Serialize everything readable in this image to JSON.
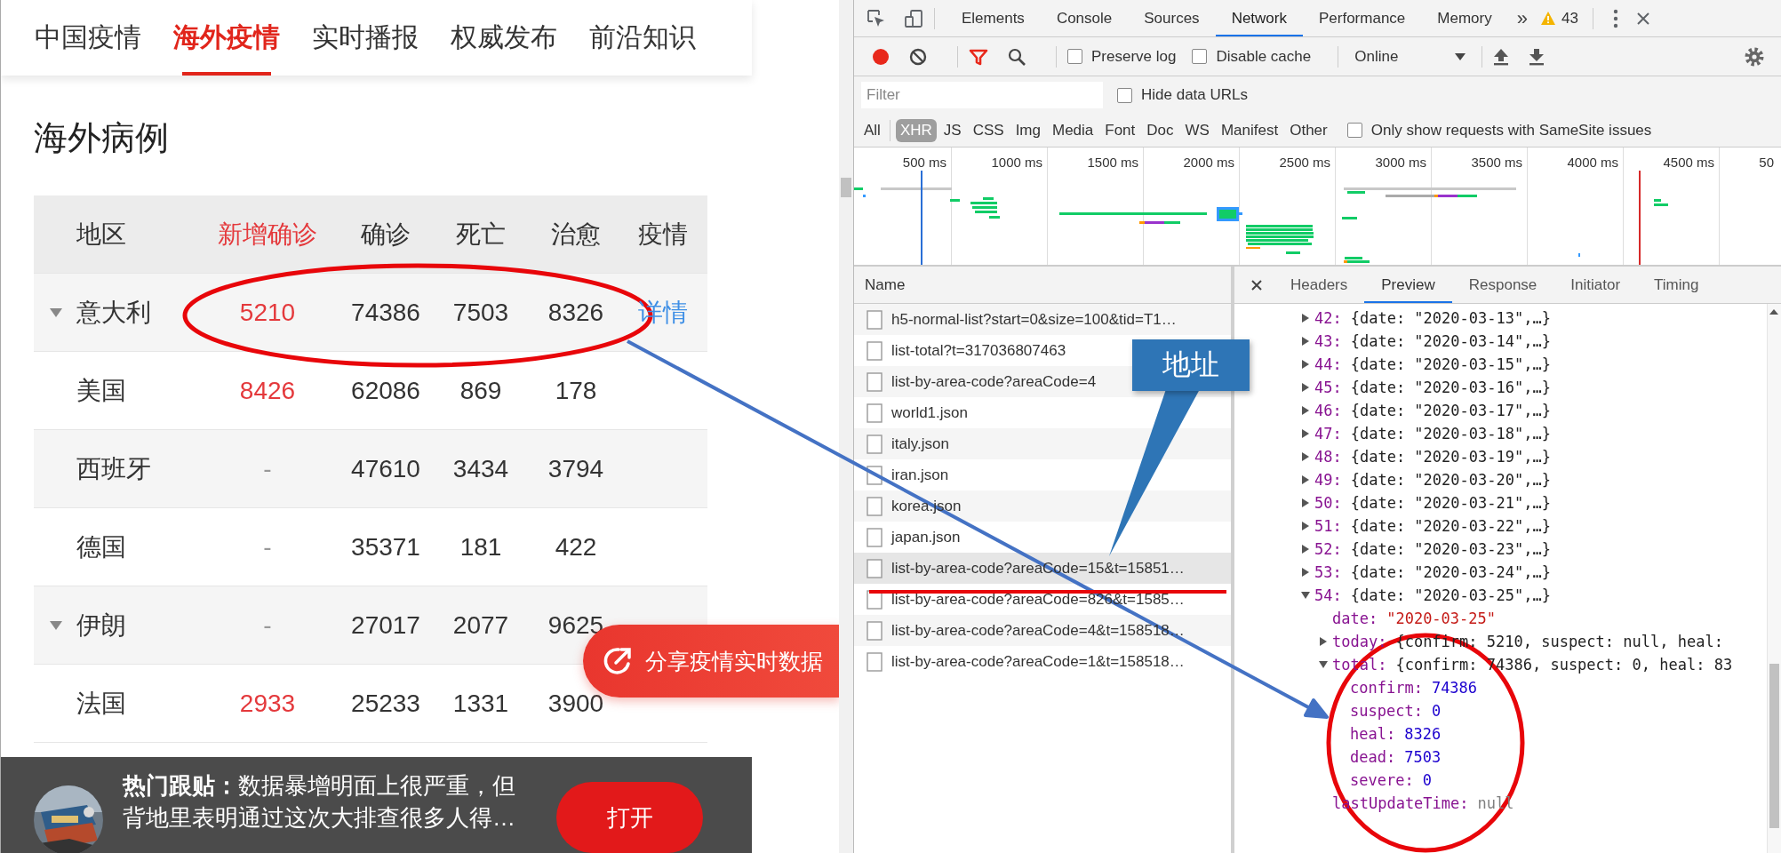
{
  "page": {
    "tabs": [
      {
        "label": "中国疫情",
        "selected": false
      },
      {
        "label": "海外疫情",
        "selected": true
      },
      {
        "label": "实时播报",
        "selected": false
      },
      {
        "label": "权威发布",
        "selected": false
      },
      {
        "label": "前沿知识",
        "selected": false
      }
    ],
    "heading": "海外病例",
    "table": {
      "columns": [
        {
          "label": "地区",
          "highlight": false
        },
        {
          "label": "新增确诊",
          "highlight": true
        },
        {
          "label": "确诊",
          "highlight": false
        },
        {
          "label": "死亡",
          "highlight": false
        },
        {
          "label": "治愈",
          "highlight": false
        },
        {
          "label": "疫情",
          "highlight": false
        }
      ],
      "rows": [
        {
          "region": "意大利",
          "expandable": true,
          "new_cases": "5210",
          "new_reported": true,
          "confirmed": "74386",
          "deaths": "7503",
          "recovered": "8326",
          "detail": "详情"
        },
        {
          "region": "美国",
          "expandable": false,
          "new_cases": "8426",
          "new_reported": true,
          "confirmed": "62086",
          "deaths": "869",
          "recovered": "178"
        },
        {
          "region": "西班牙",
          "expandable": false,
          "new_cases": "-",
          "new_reported": false,
          "confirmed": "47610",
          "deaths": "3434",
          "recovered": "3794"
        },
        {
          "region": "德国",
          "expandable": false,
          "new_cases": "-",
          "new_reported": false,
          "confirmed": "35371",
          "deaths": "181",
          "recovered": "422"
        },
        {
          "region": "伊朗",
          "expandable": true,
          "new_cases": "-",
          "new_reported": false,
          "confirmed": "27017",
          "deaths": "2077",
          "recovered": "9625"
        },
        {
          "region": "法国",
          "expandable": false,
          "new_cases": "2933",
          "new_reported": true,
          "confirmed": "25233",
          "deaths": "1331",
          "recovered": "3900"
        }
      ]
    },
    "share_button": "分享疫情实时数据",
    "news_bar": {
      "text": "**热门跟贴：**数据暴增明面上很严重，但背地里表明通过这次大排查很多人得…",
      "button": "打开"
    }
  },
  "devtools": {
    "panel_tabs": [
      {
        "label": "Elements",
        "selected": false
      },
      {
        "label": "Console",
        "selected": false
      },
      {
        "label": "Sources",
        "selected": false
      },
      {
        "label": "Network",
        "selected": true
      },
      {
        "label": "Performance",
        "selected": false
      },
      {
        "label": "Memory",
        "selected": false
      }
    ],
    "more_tabs": "»",
    "warning_count": "43",
    "recording": true,
    "filter_active": true,
    "toolbar_checkboxes": [
      {
        "label": "Preserve log",
        "checked": false
      },
      {
        "label": "Disable cache",
        "checked": false
      }
    ],
    "throttling": "Online",
    "filter_placeholder": "Filter",
    "hide_data_urls": {
      "label": "Hide data URLs",
      "checked": false
    },
    "type_filters": [
      {
        "label": "All",
        "selected": false
      },
      {
        "label": "XHR",
        "selected": true
      },
      {
        "label": "JS",
        "selected": false
      },
      {
        "label": "CSS",
        "selected": false
      },
      {
        "label": "Img",
        "selected": false
      },
      {
        "label": "Media",
        "selected": false
      },
      {
        "label": "Font",
        "selected": false
      },
      {
        "label": "Doc",
        "selected": false
      },
      {
        "label": "WS",
        "selected": false
      },
      {
        "label": "Manifest",
        "selected": false
      },
      {
        "label": "Other",
        "selected": false
      }
    ],
    "samesite_filter": {
      "label": "Only show requests with SameSite issues",
      "checked": false
    },
    "timeline_ticks": [
      "500 ms",
      "1000 ms",
      "1500 ms",
      "2000 ms",
      "2500 ms",
      "3000 ms",
      "3500 ms",
      "4000 ms",
      "4500 ms",
      "50"
    ],
    "requests_header": "Name",
    "requests": [
      {
        "name": "h5-normal-list?start=0&size=100&tid=T1…",
        "selected": false
      },
      {
        "name": "list-total?t=317036807463",
        "selected": false
      },
      {
        "name": "list-by-area-code?areaCode=4",
        "selected": false
      },
      {
        "name": "world1.json",
        "selected": false
      },
      {
        "name": "italy.json",
        "selected": false
      },
      {
        "name": "iran.json",
        "selected": false
      },
      {
        "name": "korea.json",
        "selected": false
      },
      {
        "name": "japan.json",
        "selected": false
      },
      {
        "name": "list-by-area-code?areaCode=15&t=15851…",
        "selected": true
      },
      {
        "name": "list-by-area-code?areaCode=826&t=1585…",
        "selected": false
      },
      {
        "name": "list-by-area-code?areaCode=4&t=158518…",
        "selected": false
      },
      {
        "name": "list-by-area-code?areaCode=1&t=158518…",
        "selected": false
      }
    ],
    "detail_tabs": [
      {
        "label": "Headers",
        "selected": false
      },
      {
        "label": "Preview",
        "selected": true
      },
      {
        "label": "Response",
        "selected": false
      },
      {
        "label": "Initiator",
        "selected": false
      },
      {
        "label": "Timing",
        "selected": false
      }
    ],
    "preview": [
      {
        "key": "42:",
        "summary": "{date: \"2020-03-13\",…}",
        "expanded": false
      },
      {
        "key": "43:",
        "summary": "{date: \"2020-03-14\",…}",
        "expanded": false
      },
      {
        "key": "44:",
        "summary": "{date: \"2020-03-15\",…}",
        "expanded": false
      },
      {
        "key": "45:",
        "summary": "{date: \"2020-03-16\",…}",
        "expanded": false
      },
      {
        "key": "46:",
        "summary": "{date: \"2020-03-17\",…}",
        "expanded": false
      },
      {
        "key": "47:",
        "summary": "{date: \"2020-03-18\",…}",
        "expanded": false
      },
      {
        "key": "48:",
        "summary": "{date: \"2020-03-19\",…}",
        "expanded": false
      },
      {
        "key": "49:",
        "summary": "{date: \"2020-03-20\",…}",
        "expanded": false
      },
      {
        "key": "50:",
        "summary": "{date: \"2020-03-21\",…}",
        "expanded": false
      },
      {
        "key": "51:",
        "summary": "{date: \"2020-03-22\",…}",
        "expanded": false
      },
      {
        "key": "52:",
        "summary": "{date: \"2020-03-23\",…}",
        "expanded": false
      },
      {
        "key": "53:",
        "summary": "{date: \"2020-03-24\",…}",
        "expanded": false
      },
      {
        "key": "54:",
        "summary": "{date: \"2020-03-25\",…}",
        "expanded": true,
        "children": [
          {
            "key": "date:",
            "value": "\"2020-03-25\"",
            "kind": "string"
          },
          {
            "key": "today:",
            "summary": "{confirm: 5210, suspect: null, heal:",
            "expanded": false
          },
          {
            "key": "total:",
            "summary": "{confirm: 74386, suspect: 0, heal: 83",
            "expanded": true,
            "children": [
              {
                "key": "confirm:",
                "value": "74386",
                "kind": "number"
              },
              {
                "key": "suspect:",
                "value": "0",
                "kind": "number"
              },
              {
                "key": "heal:",
                "value": "8326",
                "kind": "number"
              },
              {
                "key": "dead:",
                "value": "7503",
                "kind": "number"
              },
              {
                "key": "severe:",
                "value": "0",
                "kind": "number"
              }
            ]
          },
          {
            "key": "lastUpdateTime:",
            "value": "null",
            "kind": "null"
          }
        ]
      }
    ]
  },
  "annotation": {
    "callout": "地址"
  }
}
